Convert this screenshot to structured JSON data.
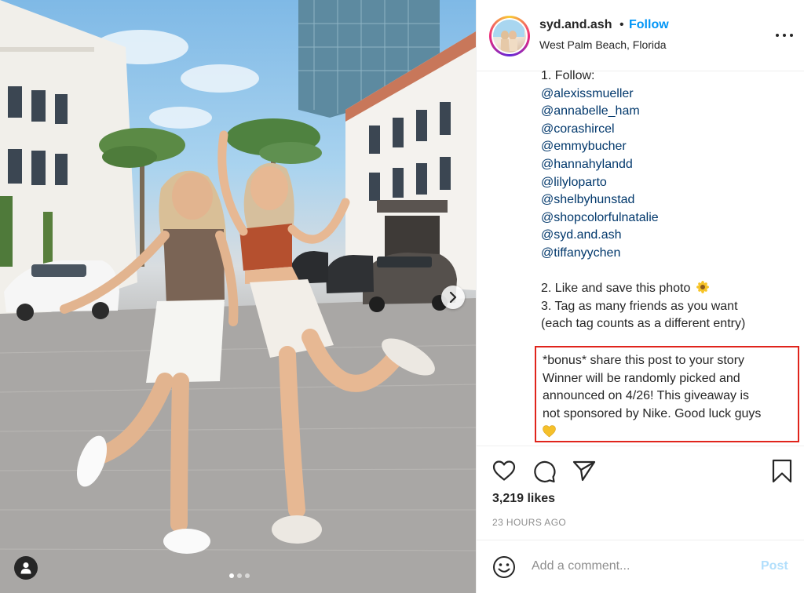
{
  "post": {
    "username": "syd.and.ash",
    "separator": "•",
    "follow_label": "Follow",
    "location": "West Palm Beach, Florida",
    "caption_lines": {
      "follow_heading": "1. Follow:",
      "mentions": [
        "@alexissmueller",
        "@annabelle_ham",
        "@corashircel",
        "@emmybucher",
        "@hannahylandd",
        "@lilyloparto",
        "@shelbyhunstad",
        "@shopcolorfulnatalie",
        "@syd.and.ash",
        "@tiffanyychen"
      ],
      "step2": "2. Like and save this photo",
      "step3": "3. Tag as many friends as you want",
      "step3_note": "(each tag counts as a different entry)"
    },
    "bonus_lines": [
      "*bonus* share this post to your story",
      "Winner will be randomly picked and",
      "announced on 4/26! This giveaway is",
      "not sponsored by Nike. Good luck guys"
    ],
    "likes": "3,219 likes",
    "timestamp": "23 HOURS AGO",
    "comment_placeholder": "Add a comment...",
    "post_label": "Post",
    "carousel": {
      "total_slides": 3,
      "active_slide": 1
    }
  },
  "icons": {
    "heart": "heart-icon",
    "comment": "comment-icon",
    "share": "paper-plane-icon",
    "save": "bookmark-icon",
    "more": "more-dots-icon",
    "emoji": "smiley-icon",
    "next": "chevron-right-icon",
    "user_tag": "user-tag-icon",
    "sunflower": "sunflower-emoji",
    "yellow_heart": "yellow-heart-emoji"
  },
  "colors": {
    "link": "#00376b",
    "follow": "#0095f6",
    "highlight": "#e0241c",
    "post_disabled": "#b2dffc",
    "muted": "#8e8e8e"
  }
}
